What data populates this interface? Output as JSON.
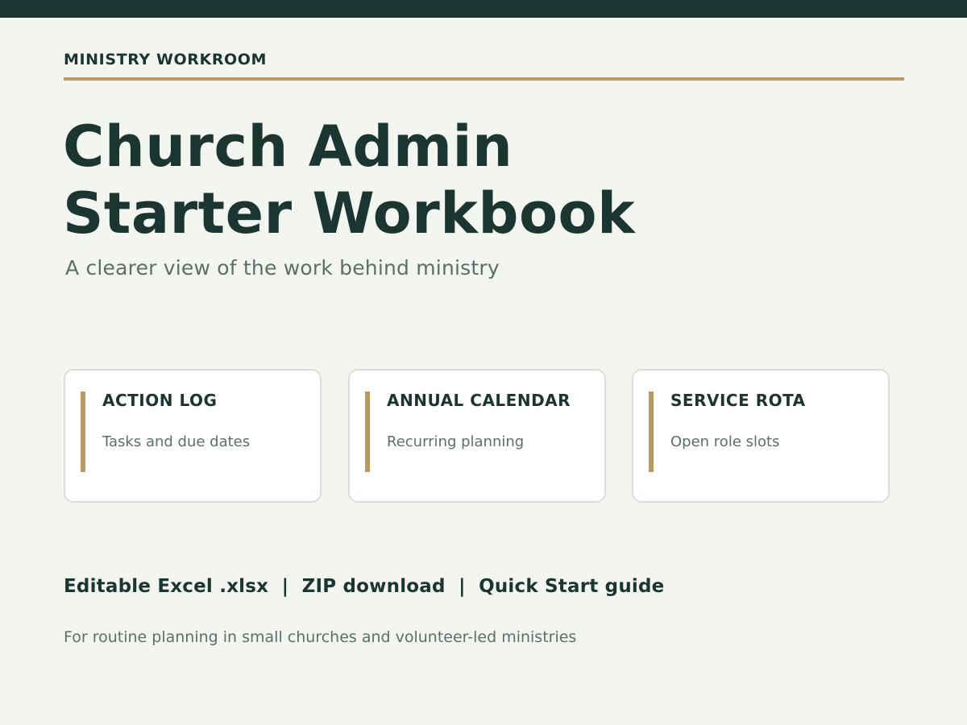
{
  "colors": {
    "dark_green": "#1b3530",
    "gold_accent": "#bc9a5f",
    "background": "#f3f5f0",
    "muted_text": "#5b6f68",
    "card_background": "#ffffff"
  },
  "header": {
    "eyebrow": "MINISTRY WORKROOM"
  },
  "hero": {
    "title_line_1": "Church Admin",
    "title_line_2": "Starter Workbook",
    "subtitle": "A clearer view of the work behind ministry"
  },
  "cards": [
    {
      "title": "ACTION LOG",
      "description": "Tasks and due dates"
    },
    {
      "title": "ANNUAL CALENDAR",
      "description": "Recurring planning"
    },
    {
      "title": "SERVICE ROTA",
      "description": "Open role slots"
    }
  ],
  "footer": {
    "features": "Editable Excel .xlsx  |  ZIP download  |  Quick Start guide",
    "note": "For routine planning in small churches and volunteer-led ministries"
  }
}
